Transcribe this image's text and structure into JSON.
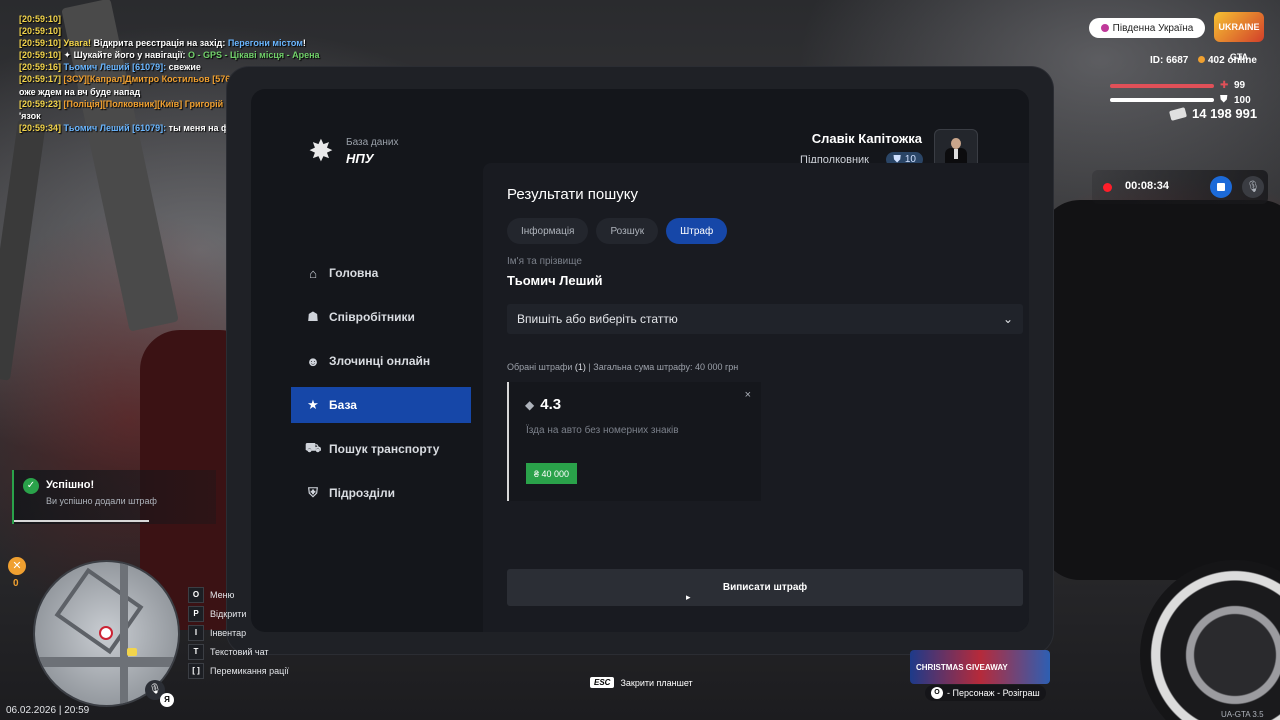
{
  "chat": [
    {
      "time": "[20:59:10]",
      "parts": []
    },
    {
      "time": "[20:59:10]",
      "parts": []
    },
    {
      "time": "[20:59:10]",
      "parts": [
        {
          "text": " Увага! ",
          "color": "yellow"
        },
        {
          "text": "Відкрита реєстрація на захід: ",
          "color": "white"
        },
        {
          "text": "Перегони містом",
          "color": "blue"
        },
        {
          "text": "!",
          "color": "white"
        }
      ]
    },
    {
      "time": "[20:59:10]",
      "parts": [
        {
          "text": " ✦ Шукайте його у навігації: ",
          "color": "white"
        },
        {
          "text": "O - GPS - Цікаві місця - Арена",
          "color": "green"
        }
      ]
    },
    {
      "time": "[20:59:16]",
      "parts": [
        {
          "text": " Тьомич Леший [61079]: ",
          "color": "blue"
        },
        {
          "text": "свежие",
          "color": "white"
        }
      ]
    },
    {
      "time": "[20:59:17]",
      "parts": [
        {
          "text": " [ЗСУ][Капрал]Дмитро Костильов [57645]: ",
          "color": "orange"
        },
        {
          "text": "(рация лейтенанта) хто м",
          "color": "white"
        }
      ]
    },
    {
      "time": "",
      "parts": [
        {
          "text": "оже ждем на вч буде напад",
          "color": "white"
        }
      ]
    },
    {
      "time": "[20:59:23]",
      "parts": [
        {
          "text": " [Поліція][Полковник][Київ] Григорій Микитинець [63674]: ",
          "color": "orange"
        },
        {
          "text": "СБУ на зв",
          "color": "white"
        }
      ]
    },
    {
      "time": "",
      "parts": [
        {
          "text": "'язок",
          "color": "white"
        }
      ]
    },
    {
      "time": "[20:59:34]",
      "parts": [
        {
          "text": " Тьомич Леший [61079]: ",
          "color": "blue"
        },
        {
          "text": "ты меня на фуре заебал",
          "color": "white"
        }
      ]
    }
  ],
  "tablet": {
    "brand": {
      "subtitle": "База даних",
      "title": "НПУ",
      "logo_icon": "police-star-icon"
    },
    "user": {
      "name": "Славік Капітожка",
      "rank": "Підполковник",
      "level": "10",
      "level_icon": "shield-icon"
    },
    "nav": [
      {
        "label": "Головна",
        "icon": "⌂",
        "icon_name": "home-icon",
        "active": false
      },
      {
        "label": "Співробітники",
        "icon": "☗",
        "icon_name": "users-icon",
        "active": false
      },
      {
        "label": "Злочинці онлайн",
        "icon": "☻",
        "icon_name": "criminal-icon",
        "active": false
      },
      {
        "label": "База",
        "icon": "★",
        "icon_name": "star-icon",
        "active": true
      },
      {
        "label": "Пошук транспорту",
        "icon": "⛟",
        "icon_name": "car-icon",
        "active": false
      },
      {
        "label": "Підрозділи",
        "icon": "⛨",
        "icon_name": "shield-icon",
        "active": false
      }
    ],
    "content": {
      "title": "Результати пошуку",
      "tabs": [
        {
          "label": "Інформація",
          "active": false
        },
        {
          "label": "Розшук",
          "active": false
        },
        {
          "label": "Штраф",
          "active": true
        }
      ],
      "name_label": "Ім'я та прізвище",
      "name_value": "Тьомич Леший",
      "select_placeholder": "Впишіть або виберіть статтю",
      "summary_prefix": "Обрані штрафи ",
      "summary_count": "(1)",
      "summary_suffix": " | Загальна сума штрафу: 40 000 грн",
      "fine": {
        "code": "4.3",
        "description": "Їзда на авто без номерних знаків",
        "amount": "₴ 40 000",
        "close": "×"
      },
      "submit_label": "Виписати штраф"
    }
  },
  "notification": {
    "title": "Успішно!",
    "text": "Ви успішно додали штраф"
  },
  "hud": {
    "server": "Південна Україна",
    "logo_text": "UKRAINE GTA",
    "id_text": "ID: 6687",
    "online_text": "402 online",
    "health": "99",
    "armor": "100",
    "money": "14 198 991",
    "record_time": "00:08:34",
    "hunger": "0"
  },
  "keymap": [
    {
      "key": "O",
      "label": "Меню"
    },
    {
      "key": "P",
      "label": "Відкрити"
    },
    {
      "key": "I",
      "label": "Інвентар"
    },
    {
      "key": "T",
      "label": "Текстовий чат"
    },
    {
      "key": "[ ]",
      "label": "Перемикання рації"
    }
  ],
  "mic_key": "Я",
  "datetime": "06.02.2026 | 20:59",
  "esc_key": "ESC",
  "esc_label": "Закрити планшет",
  "promo": {
    "banner": "CHRISTMAS GIVEAWAY",
    "key": "O",
    "label": "- Персонаж - Розіграш"
  },
  "version": "UA-GTA 3.5"
}
